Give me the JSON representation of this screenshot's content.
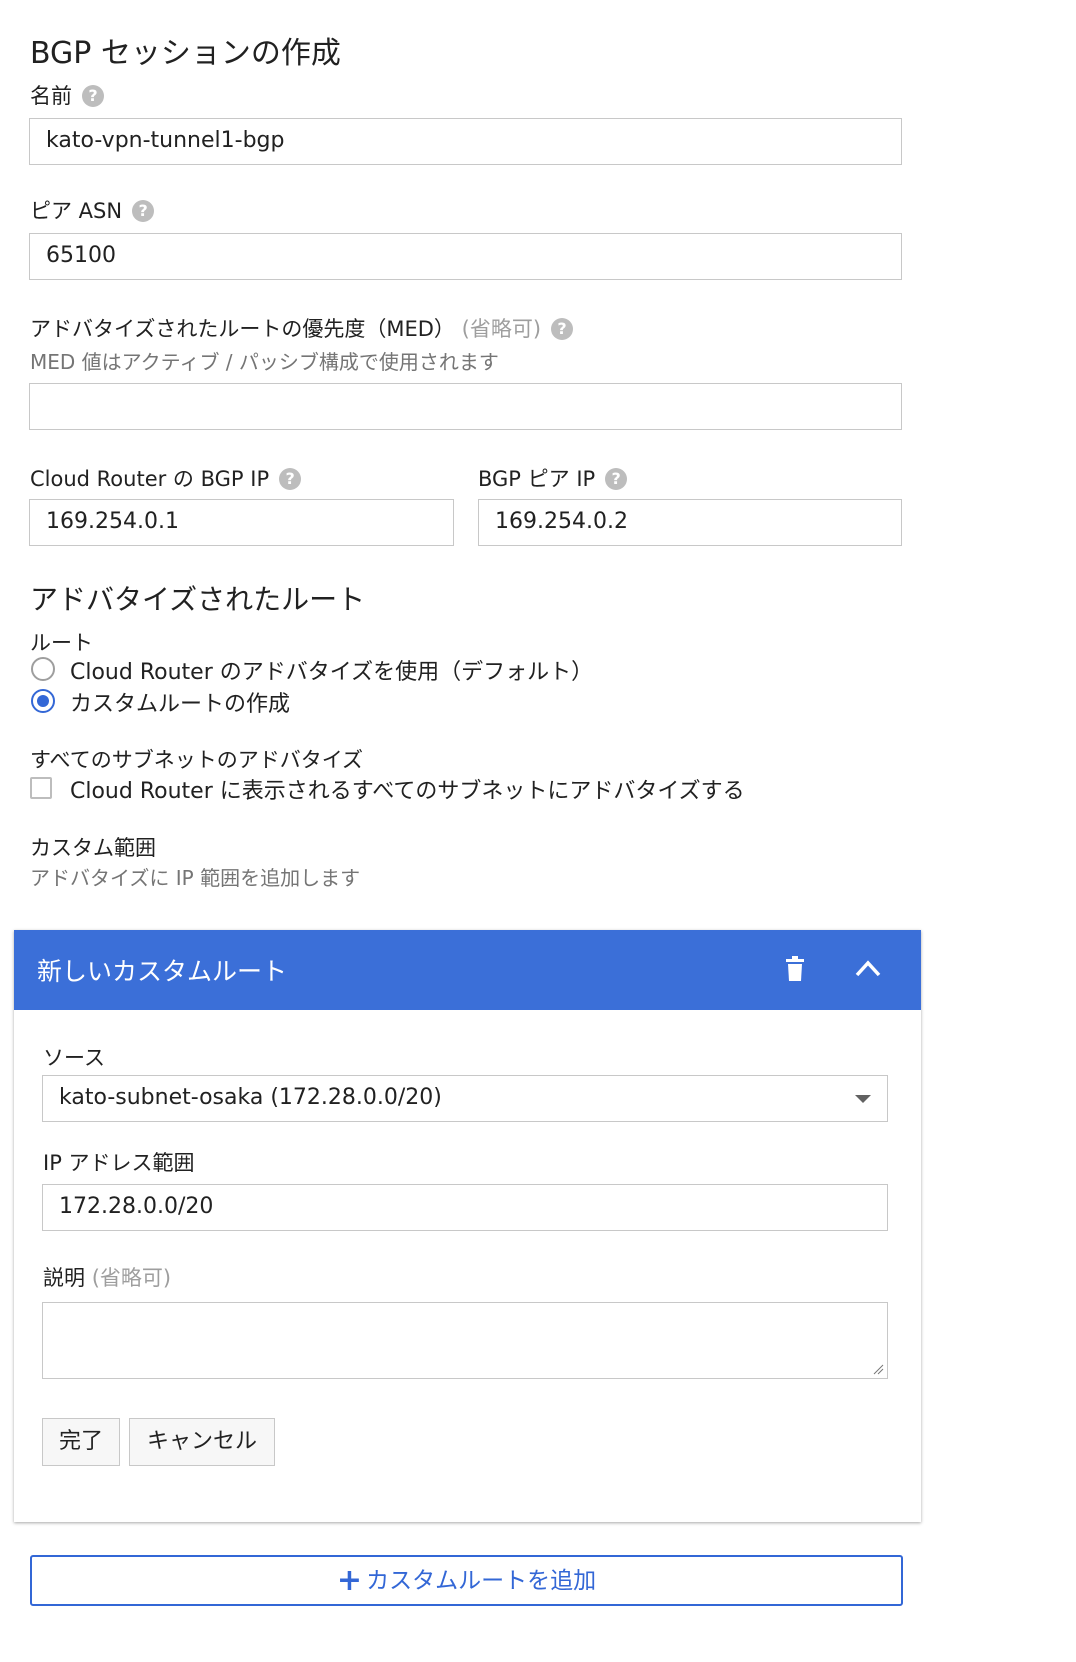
{
  "page_title": "BGP セッションの作成",
  "name_field": {
    "label": "名前",
    "value": "kato-vpn-tunnel1-bgp"
  },
  "peer_asn": {
    "label": "ピア ASN",
    "value": "65100"
  },
  "med": {
    "label": "アドバタイズされたルートの優先度（MED）",
    "optional": "(省略可)",
    "hint": "MED 値はアクティブ / パッシブ構成で使用されます",
    "value": ""
  },
  "router_ip": {
    "label": "Cloud Router の BGP IP",
    "value": "169.254.0.1"
  },
  "peer_ip": {
    "label": "BGP ピア IP",
    "value": "169.254.0.2"
  },
  "advertised": {
    "title": "アドバタイズされたルート",
    "routes_label": "ルート",
    "options": [
      {
        "label": "Cloud Router のアドバタイズを使用（デフォルト）",
        "selected": false
      },
      {
        "label": "カスタムルートの作成",
        "selected": true
      }
    ],
    "all_subnets_label": "すべてのサブネットのアドバタイズ",
    "all_subnets_checkbox": {
      "label": "Cloud Router に表示されるすべてのサブネットにアドバタイズする",
      "checked": false
    },
    "custom_range_label": "カスタム範囲",
    "custom_range_hint": "アドバタイズに IP 範囲を追加します"
  },
  "custom_route_card": {
    "title": "新しいカスタムルート",
    "header_color": "#3b6fd8",
    "source_label": "ソース",
    "source_value": "kato-subnet-osaka (172.28.0.0/20)",
    "ip_range_label": "IP アドレス範囲",
    "ip_range_value": "172.28.0.0/20",
    "description_label": "説明",
    "description_optional": "(省略可)",
    "description_value": "",
    "done_label": "完了",
    "cancel_label": "キャンセル"
  },
  "add_custom_route_label": "カスタムルートを追加",
  "add_icon": "+",
  "help_icon": "?",
  "accent_color": "#3367d6"
}
